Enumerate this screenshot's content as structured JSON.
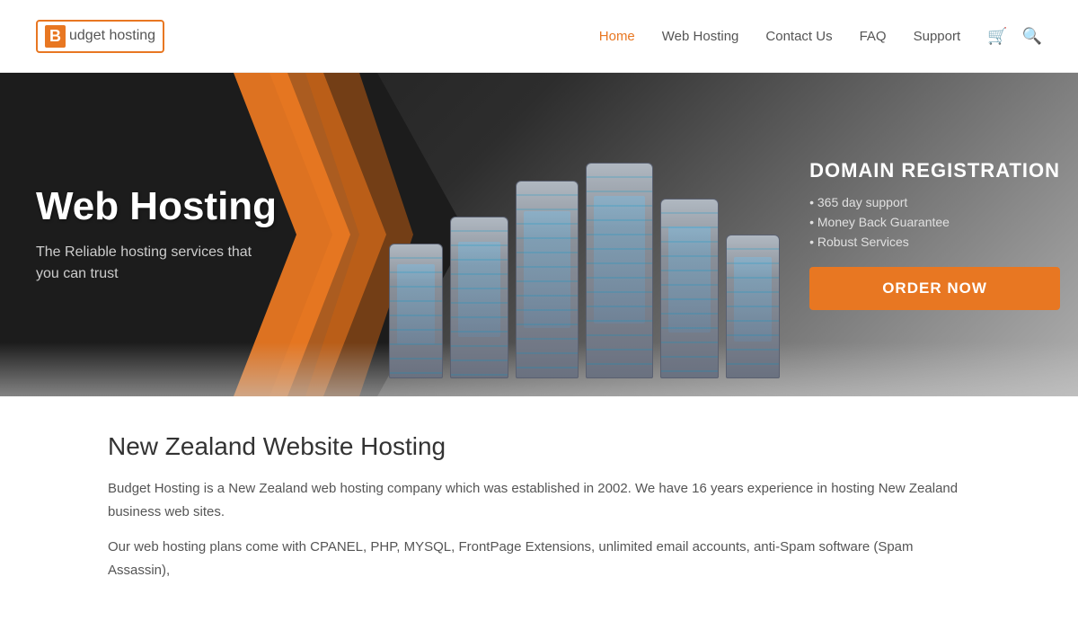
{
  "header": {
    "logo_b": "B",
    "logo_text": "udget hosting",
    "nav": {
      "home": "Home",
      "web_hosting": "Web Hosting",
      "contact_us": "Contact Us",
      "faq": "FAQ",
      "support": "Support"
    }
  },
  "hero": {
    "title": "Web Hosting",
    "subtitle_line1": "The Reliable hosting services that",
    "subtitle_line2": "you can trust",
    "domain_title": "DOMAIN REGISTRATION",
    "features": [
      "• 365 day support",
      "• Money Back Guarantee",
      "• Robust Services"
    ],
    "order_btn": "ORDER NOW"
  },
  "content": {
    "section_title": "New Zealand Website Hosting",
    "body1": "Budget Hosting is a New Zealand web hosting company which was established in 2002. We have 16 years experience in hosting New Zealand business web sites.",
    "body2": "Our web hosting plans come with CPANEL, PHP, MYSQL, FrontPage Extensions, unlimited email accounts, anti-Spam software (Spam Assassin),"
  }
}
